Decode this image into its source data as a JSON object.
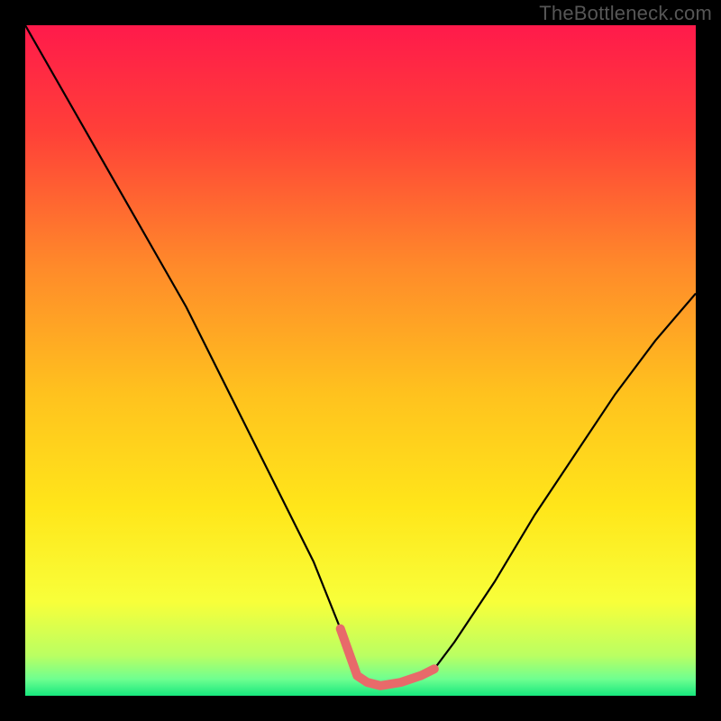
{
  "watermark": "TheBottleneck.com",
  "chart_data": {
    "type": "line",
    "title": "",
    "xlabel": "",
    "ylabel": "",
    "xlim": [
      0,
      100
    ],
    "ylim": [
      0,
      100
    ],
    "series": [
      {
        "name": "bottleneck-curve",
        "x": [
          0,
          8,
          16,
          24,
          31,
          37,
          43,
          47,
          49.5,
          51,
          53,
          56,
          59,
          61,
          64,
          70,
          76,
          82,
          88,
          94,
          100
        ],
        "values": [
          100,
          86,
          72,
          58,
          44,
          32,
          20,
          10,
          3,
          2,
          1.5,
          2,
          3,
          4,
          8,
          17,
          27,
          36,
          45,
          53,
          60
        ]
      },
      {
        "name": "valley-highlight",
        "x": [
          47,
          49.5,
          51,
          53,
          56,
          59,
          61
        ],
        "values": [
          10,
          3,
          2,
          1.5,
          2,
          3,
          4
        ]
      }
    ],
    "gradient_stops": [
      {
        "offset": 0.0,
        "color": "#ff1a4b"
      },
      {
        "offset": 0.16,
        "color": "#ff4038"
      },
      {
        "offset": 0.36,
        "color": "#ff8a2a"
      },
      {
        "offset": 0.55,
        "color": "#ffc21e"
      },
      {
        "offset": 0.72,
        "color": "#ffe61a"
      },
      {
        "offset": 0.86,
        "color": "#f8ff3a"
      },
      {
        "offset": 0.94,
        "color": "#baff62"
      },
      {
        "offset": 0.975,
        "color": "#6fff90"
      },
      {
        "offset": 1.0,
        "color": "#17e87e"
      }
    ],
    "colors": {
      "curve": "#000000",
      "highlight": "#e86a6a"
    }
  }
}
